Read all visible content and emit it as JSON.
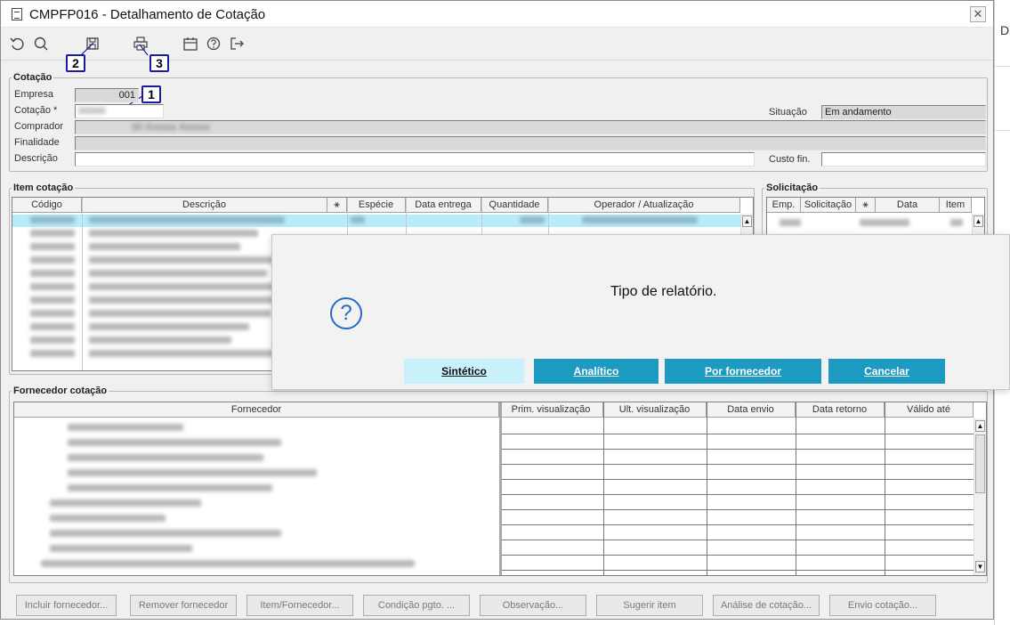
{
  "window": {
    "title": "CMPFP016 - Detalhamento de Cotação",
    "close_glyph": "✕"
  },
  "background_window": {
    "letter": "D"
  },
  "toolbar": {
    "icons": [
      "refresh-icon",
      "search-icon",
      "save-icon",
      "print-icon",
      "calendar-icon",
      "help-icon",
      "exit-icon"
    ],
    "callouts": [
      "1",
      "2",
      "3"
    ]
  },
  "cotacao": {
    "legend": "Cotação",
    "empresa_label": "Empresa",
    "empresa_value": "001",
    "cotacao_label": "Cotação *",
    "comprador_label": "Comprador",
    "finalidade_label": "Finalidade",
    "descricao_label": "Descrição",
    "situacao_label": "Situação",
    "situacao_value": "Em andamento",
    "custo_label": "Custo fin."
  },
  "item_cotacao": {
    "legend": "Item cotação",
    "columns": [
      "Código",
      "Descrição",
      "⚹",
      "Espécie",
      "Data entrega",
      "Quantidade",
      "Operador / Atualização"
    ]
  },
  "solicitacao": {
    "legend": "Solicitação",
    "columns": [
      "Emp.",
      "Solicitação",
      "⚹",
      "Data",
      "Item"
    ]
  },
  "fornecedor_cotacao": {
    "legend": "Fornecedor cotação",
    "columns": [
      "Fornecedor",
      "Prim. visualização",
      "Ult. visualização",
      "Data envio",
      "Data retorno",
      "Válido até"
    ]
  },
  "bottom_buttons": [
    "Incluir fornecedor...",
    "Remover fornecedor",
    "Item/Fornecedor...",
    "Condição pgto. ...",
    "Observação...",
    "Sugerir item",
    "Análise de cotação...",
    "Envio cotação..."
  ],
  "dialog": {
    "message": "Tipo de relatório.",
    "icon": "?",
    "buttons": [
      "Sintético",
      "Analítico",
      "Por fornecedor",
      "Cancelar"
    ]
  }
}
